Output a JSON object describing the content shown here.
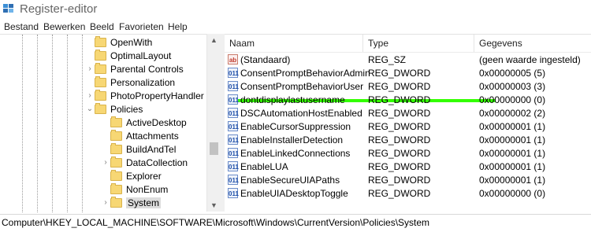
{
  "window": {
    "title": "Register-editor"
  },
  "menu": [
    "Bestand",
    "Bewerken",
    "Beeld",
    "Favorieten",
    "Help"
  ],
  "tree": {
    "items": [
      {
        "label": "OpenWith",
        "level": 1,
        "expander": ""
      },
      {
        "label": "OptimalLayout",
        "level": 1,
        "expander": ""
      },
      {
        "label": "Parental Controls",
        "level": 1,
        "expander": "›"
      },
      {
        "label": "Personalization",
        "level": 1,
        "expander": ""
      },
      {
        "label": "PhotoPropertyHandler",
        "level": 1,
        "expander": "›"
      },
      {
        "label": "Policies",
        "level": 1,
        "expander": "⌄"
      },
      {
        "label": "ActiveDesktop",
        "level": 2,
        "expander": ""
      },
      {
        "label": "Attachments",
        "level": 2,
        "expander": ""
      },
      {
        "label": "BuildAndTel",
        "level": 2,
        "expander": ""
      },
      {
        "label": "DataCollection",
        "level": 2,
        "expander": "›"
      },
      {
        "label": "Explorer",
        "level": 2,
        "expander": ""
      },
      {
        "label": "NonEnum",
        "level": 2,
        "expander": ""
      },
      {
        "label": "System",
        "level": 2,
        "expander": "›",
        "selected": true
      }
    ],
    "scroll_up": "▲",
    "scroll_down": "▼"
  },
  "list": {
    "columns": [
      "Naam",
      "Type",
      "Gegevens"
    ],
    "rows": [
      {
        "name": "(Standaard)",
        "type": "REG_SZ",
        "data": "(geen waarde ingesteld)",
        "icon": "ab",
        "icon_kind": "sz"
      },
      {
        "name": "ConsentPromptBehaviorAdmin",
        "type": "REG_DWORD",
        "data": "0x00000005 (5)",
        "icon": "011",
        "icon_kind": "dword"
      },
      {
        "name": "ConsentPromptBehaviorUser",
        "type": "REG_DWORD",
        "data": "0x00000003 (3)",
        "icon": "011",
        "icon_kind": "dword"
      },
      {
        "name": "dontdisplaylastusername",
        "type": "REG_DWORD",
        "data": "0x00000000 (0)",
        "icon": "011",
        "icon_kind": "dword",
        "highlighted": true
      },
      {
        "name": "DSCAutomationHostEnabled",
        "type": "REG_DWORD",
        "data": "0x00000002 (2)",
        "icon": "011",
        "icon_kind": "dword"
      },
      {
        "name": "EnableCursorSuppression",
        "type": "REG_DWORD",
        "data": "0x00000001 (1)",
        "icon": "011",
        "icon_kind": "dword"
      },
      {
        "name": "EnableInstallerDetection",
        "type": "REG_DWORD",
        "data": "0x00000001 (1)",
        "icon": "011",
        "icon_kind": "dword"
      },
      {
        "name": "EnableLinkedConnections",
        "type": "REG_DWORD",
        "data": "0x00000001 (1)",
        "icon": "011",
        "icon_kind": "dword"
      },
      {
        "name": "EnableLUA",
        "type": "REG_DWORD",
        "data": "0x00000001 (1)",
        "icon": "011",
        "icon_kind": "dword"
      },
      {
        "name": "EnableSecureUIAPaths",
        "type": "REG_DWORD",
        "data": "0x00000001 (1)",
        "icon": "011",
        "icon_kind": "dword"
      },
      {
        "name": "EnableUIADesktopToggle",
        "type": "REG_DWORD",
        "data": "0x00000000 (0)",
        "icon": "011",
        "icon_kind": "dword"
      }
    ],
    "highlight_color": "#33ff00"
  },
  "status": {
    "path": "Computer\\HKEY_LOCAL_MACHINE\\SOFTWARE\\Microsoft\\Windows\\CurrentVersion\\Policies\\System"
  }
}
